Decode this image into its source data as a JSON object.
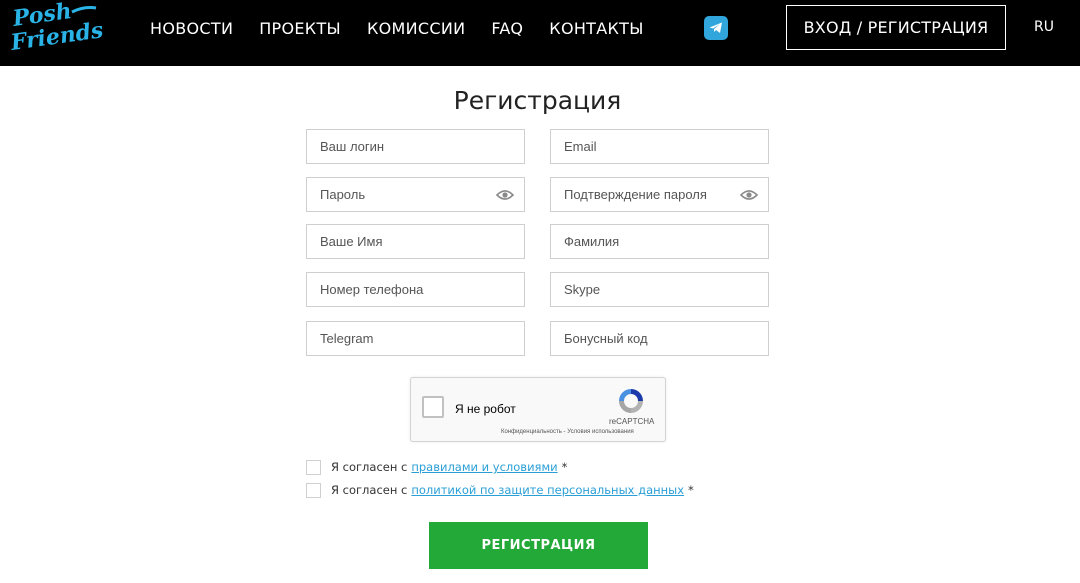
{
  "header": {
    "logo_line1": "Posh",
    "logo_line2": "Friends",
    "nav": [
      "НОВОСТИ",
      "ПРОЕКТЫ",
      "КОМИССИИ",
      "FAQ",
      "КОНТАКТЫ"
    ],
    "telegram_icon": "telegram-icon",
    "login_label": "ВХОД / РЕГИСТРАЦИЯ",
    "lang": "RU"
  },
  "form": {
    "title": "Регистрация",
    "fields": {
      "login": "Ваш логин",
      "email": "Email",
      "password": "Пароль",
      "password_confirm": "Подтверждение пароля",
      "first_name": "Ваше Имя",
      "last_name": "Фамилия",
      "phone": "Номер телефона",
      "skype": "Skype",
      "telegram": "Telegram",
      "bonus": "Бонусный код"
    },
    "captcha": {
      "label": "Я не робот",
      "brand": "reCAPTCHA",
      "links": "Конфиденциальность - Условия использования"
    },
    "agree1": {
      "text": "Я согласен с",
      "link": "правилами и условиями",
      "star": "*"
    },
    "agree2": {
      "text": "Я согласен с",
      "link": "политикой по защите персональных данных",
      "star": "*"
    },
    "submit_label": "РЕГИСТРАЦИЯ"
  },
  "colors": {
    "header_bg": "#000000",
    "accent_green": "#22a938",
    "link_blue": "#2a9fd6",
    "logo_blue": "#2ab3e6",
    "telegram_blue": "#30a6dc"
  }
}
